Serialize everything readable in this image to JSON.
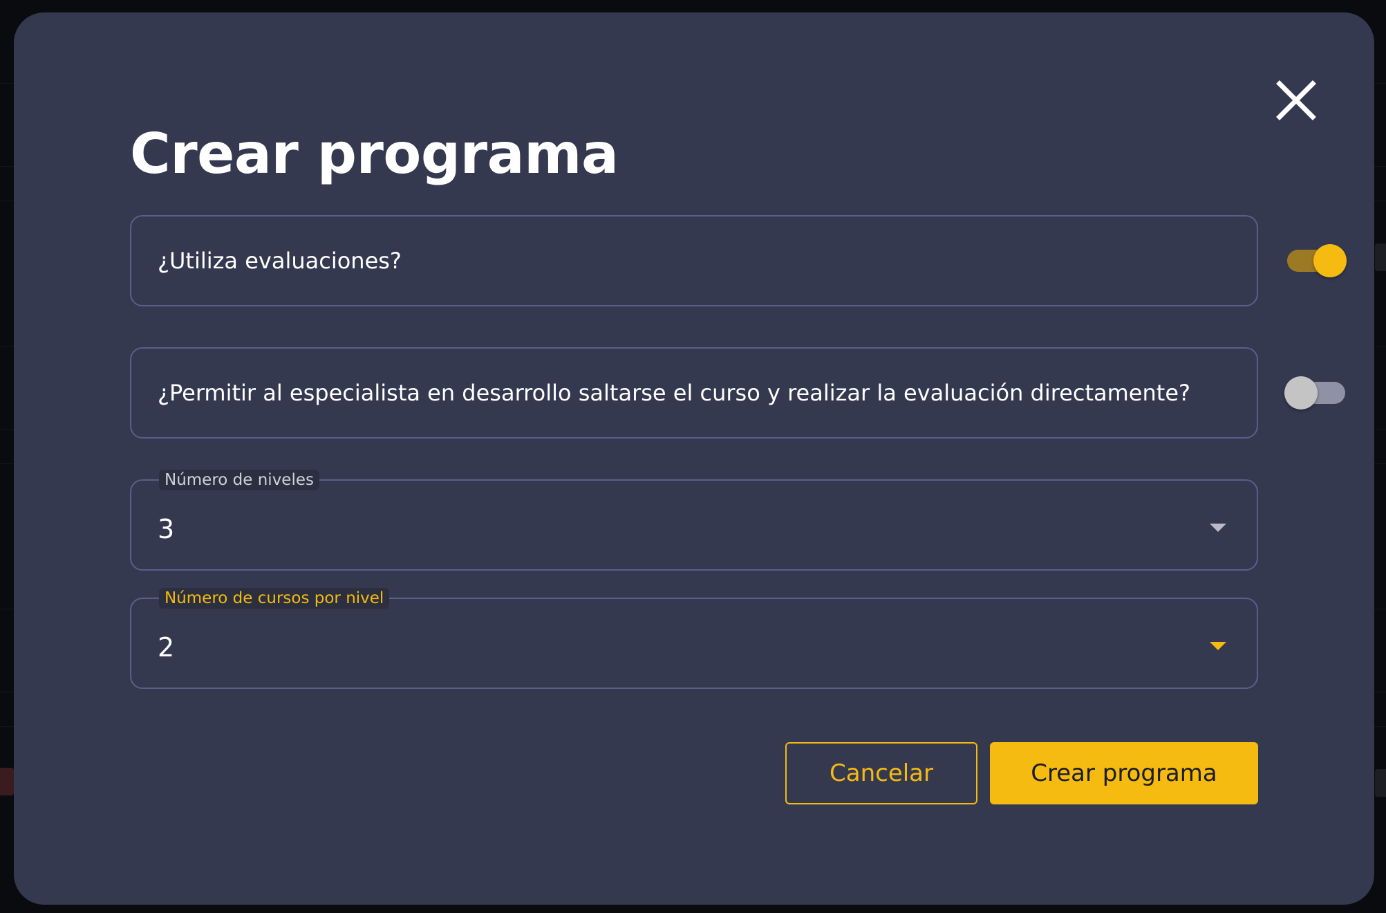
{
  "modal": {
    "title": "Crear programa",
    "close_icon": "close-icon",
    "use_evaluations": {
      "label": "¿Utiliza evaluaciones?",
      "enabled": true
    },
    "allow_skip_course": {
      "label": "¿Permitir al especialista en desarrollo saltarse el curso y realizar la evaluación directamente?",
      "enabled": false
    },
    "levels_select": {
      "label": "Número de niveles",
      "value": "3"
    },
    "courses_per_level_select": {
      "label": "Número de cursos por nivel",
      "value": "2"
    },
    "buttons": {
      "cancel": "Cancelar",
      "create": "Crear programa"
    }
  },
  "colors": {
    "modal_bg": "#353950",
    "accent": "#f5bb10",
    "border": "#5a5f88",
    "toggle_off_track": "#8f92a4",
    "label_inactive": "#cfd1dc"
  }
}
